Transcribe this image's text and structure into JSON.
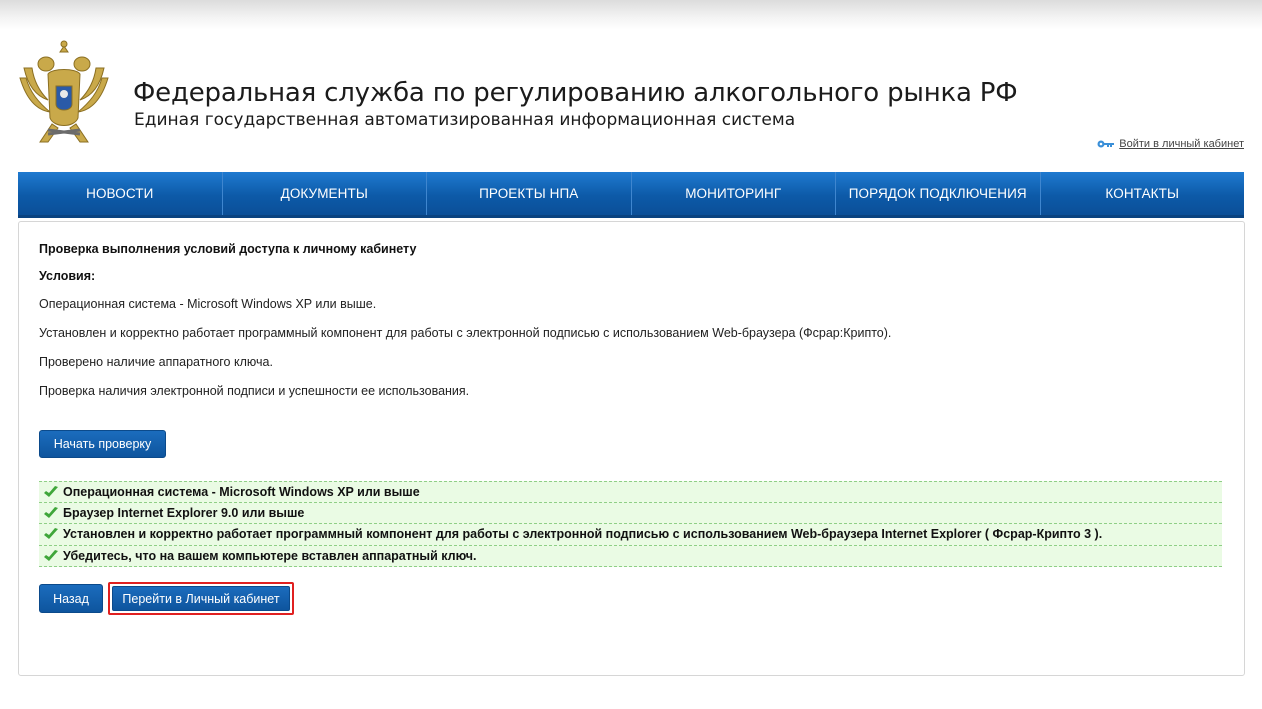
{
  "header": {
    "title": "Федеральная служба по регулированию алкогольного рынка РФ",
    "subtitle": "Единая государственная автоматизированная информационная система",
    "login_link": "Войти в личный кабинет",
    "emblem_icon": "double-headed-eagle-emblem",
    "key_icon": "key-icon"
  },
  "nav": {
    "items": [
      {
        "label": "НОВОСТИ"
      },
      {
        "label": "ДОКУМЕНТЫ"
      },
      {
        "label": "ПРОЕКТЫ НПА"
      },
      {
        "label": "МОНИТОРИНГ"
      },
      {
        "label": "ПОРЯДОК ПОДКЛЮЧЕНИЯ"
      },
      {
        "label": "КОНТАКТЫ"
      }
    ]
  },
  "content": {
    "heading": "Проверка выполнения условий доступа к личному кабинету",
    "conditions_label": "Условия:",
    "conditions": [
      "Операционная система - Microsoft Windows XP или выше.",
      "Установлен и корректно работает программный компонент для работы с электронной подписью с использованием Web-браузера (Фсрар:Крипто).",
      "Проверено наличие аппаратного ключа.",
      "Проверка наличия электронной подписи и успешности ее использования."
    ],
    "start_button": "Начать проверку",
    "results": [
      "Операционная система - Microsoft Windows XP или выше",
      "Браузер Internet Explorer 9.0 или выше",
      "Установлен и корректно работает программный компонент для работы с электронной подписью с использованием Web-браузера Internet Explorer ( Фсрар-Крипто 3 ).",
      "Убедитесь, что на вашем компьютере вставлен аппаратный ключ."
    ],
    "back_button": "Назад",
    "cabinet_button": "Перейти в Личный кабинет"
  },
  "colors": {
    "nav_blue": "#0d5aa8",
    "button_blue": "#1464b0",
    "success_bg": "#eafbe4",
    "check_green": "#3fa63a",
    "highlight_red": "#e02020"
  }
}
